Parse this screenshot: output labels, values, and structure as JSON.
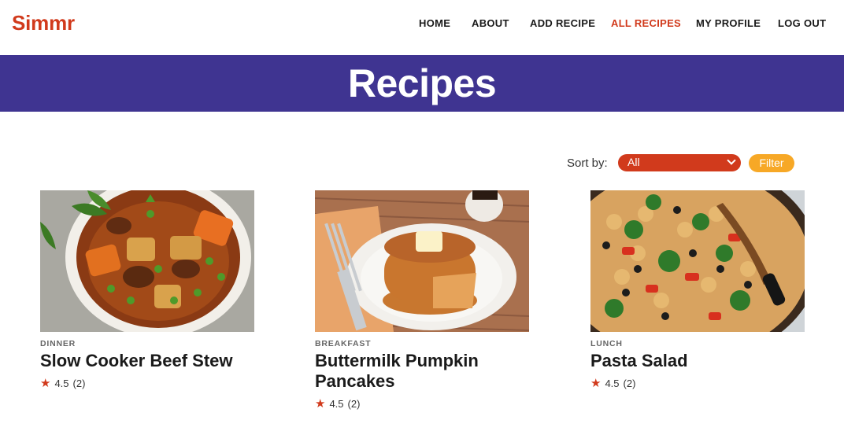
{
  "brand": "Simmr",
  "nav": [
    {
      "label": "HOME",
      "active": false
    },
    {
      "label": "ABOUT",
      "active": false
    },
    {
      "label": "ADD RECIPE",
      "active": false
    },
    {
      "label": "ALL RECIPES",
      "active": true
    },
    {
      "label": "MY PROFILE",
      "active": false
    },
    {
      "label": "LOG OUT",
      "active": false
    }
  ],
  "banner": {
    "title": "Recipes"
  },
  "sort": {
    "label": "Sort by:",
    "selected": "All",
    "filter_label": "Filter"
  },
  "recipes": [
    {
      "category": "DINNER",
      "title": "Slow Cooker Beef Stew",
      "rating": "4.5",
      "count": "(2)",
      "image": "beef-stew-photo"
    },
    {
      "category": "BREAKFAST",
      "title": "Buttermilk Pumpkin Pancakes",
      "rating": "4.5",
      "count": "(2)",
      "image": "pumpkin-pancakes-photo"
    },
    {
      "category": "LUNCH",
      "title": "Pasta Salad",
      "rating": "4.5",
      "count": "(2)",
      "image": "pasta-salad-photo"
    }
  ],
  "colors": {
    "brand": "#d13a1c",
    "banner": "#3f3491",
    "filter": "#f7a826"
  }
}
